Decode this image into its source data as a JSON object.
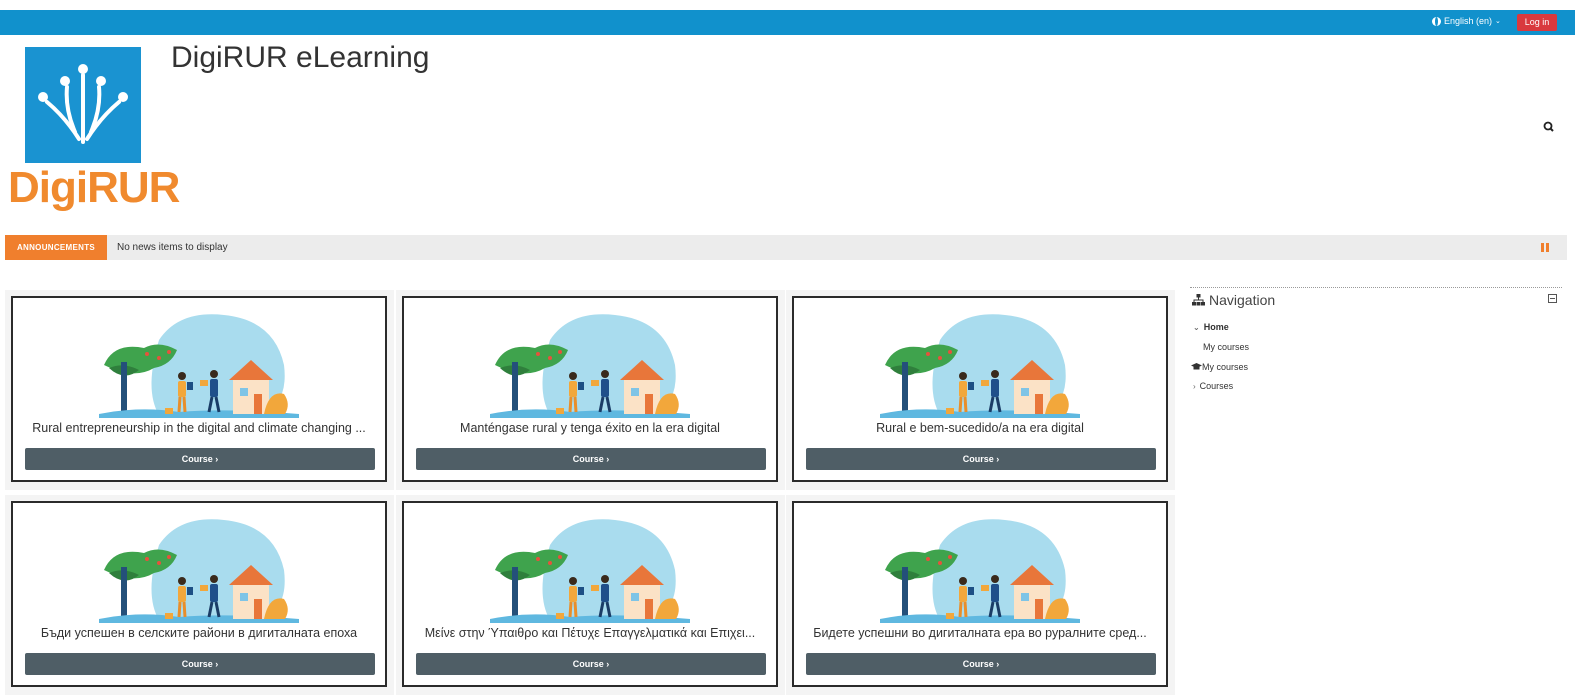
{
  "topbar": {
    "language": "English (en)",
    "login_label": "Log in"
  },
  "header": {
    "logo_text": "DigiRUR",
    "site_title": "DigiRUR eLearning"
  },
  "announcements": {
    "badge": "ANNOUNCEMENTS",
    "text": "No news items to display"
  },
  "courses": [
    {
      "title": "Rural entrepreneurship in the digital and climate changing ...",
      "button": "Course ›"
    },
    {
      "title": "Manténgase rural y tenga éxito en la era digital",
      "button": "Course ›"
    },
    {
      "title": "Rural e bem-sucedido/a na era digital",
      "button": "Course ›"
    },
    {
      "title": "Бъди успешен в селските райони в дигиталната епоха",
      "button": "Course ›"
    },
    {
      "title": "Μείνε στην Ύπαιθρο και Πέτυχε Επαγγελματικά και Επιχει...",
      "button": "Course ›"
    },
    {
      "title": "Бидете успешни во дигиталната ера во руралните сред...",
      "button": "Course ›"
    }
  ],
  "navigation": {
    "title": "Navigation",
    "items": [
      {
        "label": "Home"
      },
      {
        "label": "My courses"
      },
      {
        "label": "My courses"
      },
      {
        "label": "Courses"
      }
    ]
  },
  "colors": {
    "topbar": "#1191cc",
    "login": "#d9393e",
    "accent_orange": "#f07f2d",
    "course_button": "#4f5e66",
    "logo_blue": "#1a93d1"
  }
}
